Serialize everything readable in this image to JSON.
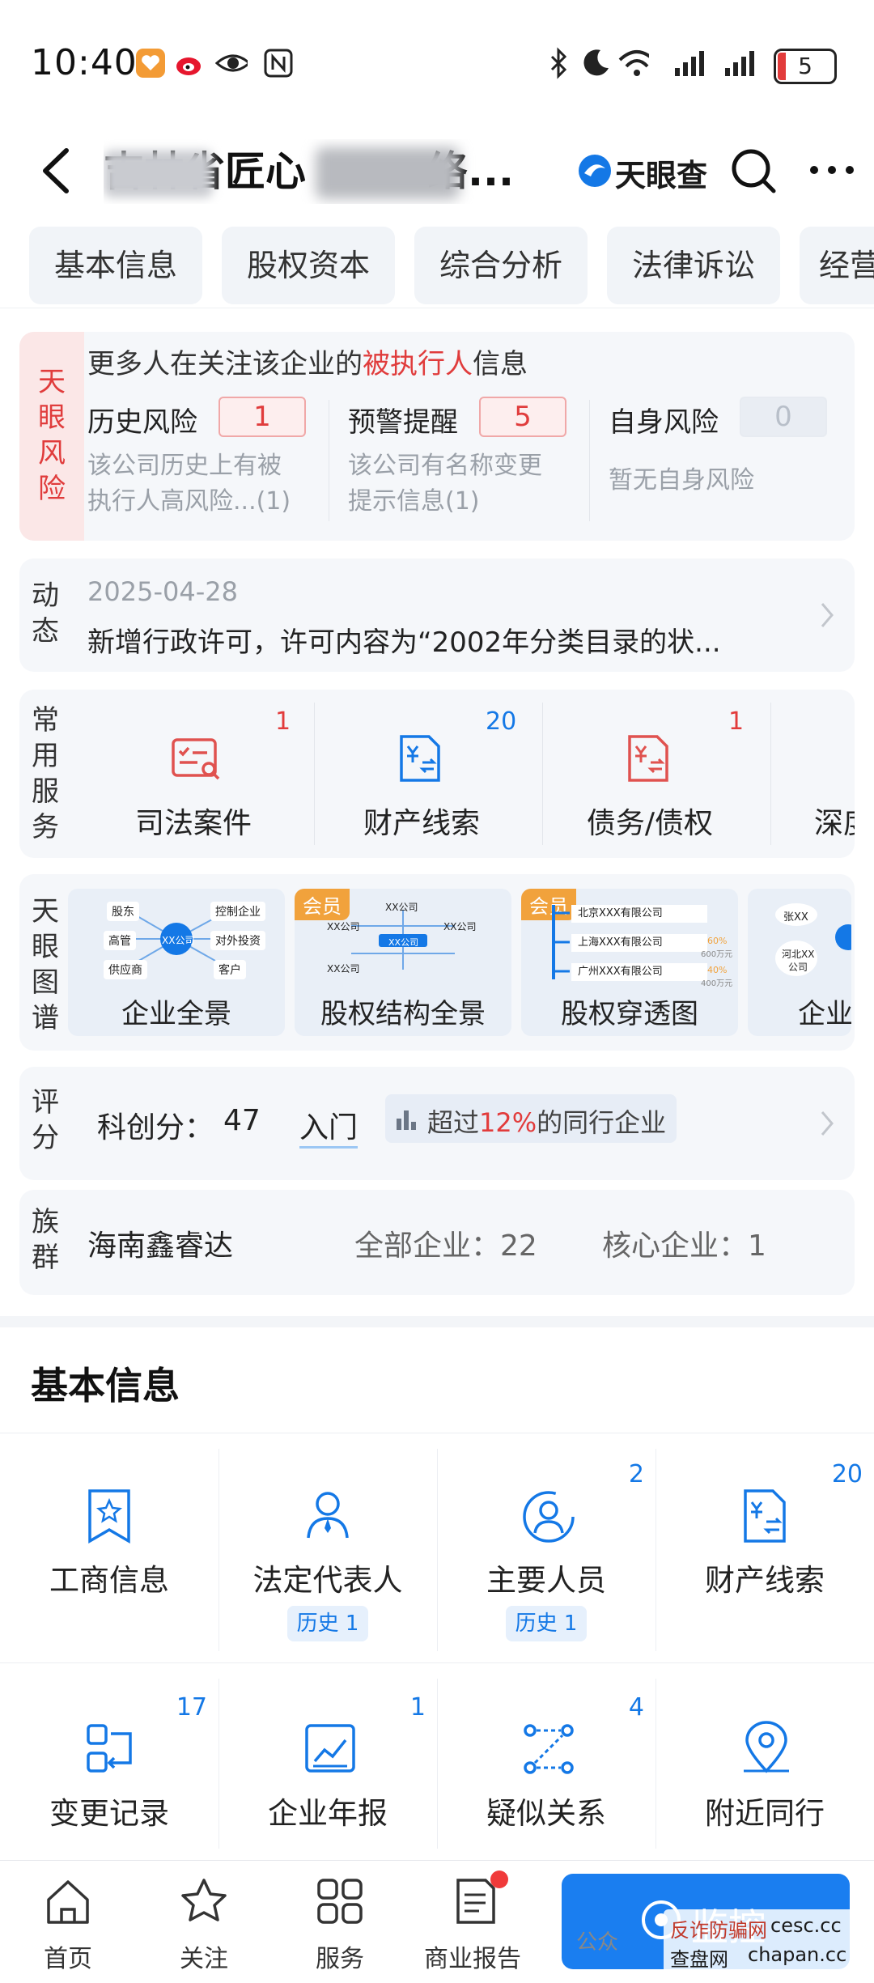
{
  "status_bar": {
    "time": "10:40",
    "battery": "5"
  },
  "header": {
    "title_left": "吉林省匠心",
    "title_right": "络...",
    "logo_text": "天眼查"
  },
  "tabs": [
    "基本信息",
    "股权资本",
    "综合分析",
    "法律诉讼",
    "经营"
  ],
  "risk": {
    "side_label": [
      "天",
      "眼",
      "风",
      "险"
    ],
    "headline_pre": "更多人在关注该企业的",
    "headline_red": "被执行人",
    "headline_post": "信息",
    "items": [
      {
        "title": "历史风险",
        "count": "1",
        "desc1": "该公司历史上有被",
        "desc2": "执行人高风险...(1)"
      },
      {
        "title": "预警提醒",
        "count": "5",
        "desc1": "该公司有名称变更",
        "desc2": "提示信息(1)"
      },
      {
        "title": "自身风险",
        "count": "0",
        "desc1": "暂无自身风险",
        "desc2": ""
      }
    ]
  },
  "news": {
    "side_label": [
      "动",
      "态"
    ],
    "date": "2025-04-28",
    "text": "新增行政许可，许可内容为“2002年分类目录的状..."
  },
  "services": {
    "side_label": [
      "常",
      "用",
      "服",
      "务"
    ],
    "items": [
      {
        "label": "司法案件",
        "count": "1",
        "icon": "judicial-case-icon"
      },
      {
        "label": "财产线索",
        "count": "20",
        "icon": "property-clue-icon"
      },
      {
        "label": "债务/债权",
        "count": "1",
        "icon": "debt-icon"
      },
      {
        "label": "深度",
        "count": "",
        "icon": "deep-icon"
      }
    ]
  },
  "graphs": {
    "side_label": [
      "天",
      "眼",
      "图",
      "谱"
    ],
    "items": [
      {
        "label": "企业全景",
        "vip": "",
        "nodes": [
          "股东",
          "控制企业",
          "高管",
          "XX公司",
          "对外投资",
          "供应商",
          "客户"
        ]
      },
      {
        "label": "股权结构全景",
        "vip": "会员",
        "nodes": [
          "XX公司",
          "XX公司",
          "XX公司",
          "XX公司",
          "XX公司"
        ]
      },
      {
        "label": "股权穿透图",
        "vip": "会员",
        "nodes": [
          "北京XXX有限公司",
          "上海XXX有限公司",
          "广州XXX有限公司",
          "60%",
          "600万元",
          "40%",
          "400万元"
        ]
      },
      {
        "label": "企业",
        "vip": "",
        "nodes": [
          "张XX",
          "河北XX",
          "公司"
        ]
      }
    ]
  },
  "score": {
    "side_label": [
      "评",
      "分"
    ],
    "label": "科创分：",
    "value": "47",
    "level": "入门",
    "exceed_pre": "超过",
    "exceed_pct": "12%",
    "exceed_post": "的同行企业"
  },
  "group": {
    "side_label": [
      "族",
      "群"
    ],
    "name": "海南鑫睿达",
    "all_label": "全部企业：",
    "all_count": "22",
    "core_label": "核心企业：",
    "core_count": "1"
  },
  "basic_info": {
    "title": "基本信息",
    "items": [
      {
        "label": "工商信息",
        "count": "",
        "history": "",
        "icon": "business-info-icon"
      },
      {
        "label": "法定代表人",
        "count": "",
        "history": "历史 1",
        "icon": "legal-rep-icon"
      },
      {
        "label": "主要人员",
        "count": "2",
        "history": "历史 1",
        "icon": "key-people-icon"
      },
      {
        "label": "财产线索",
        "count": "20",
        "history": "",
        "icon": "property-clue-icon"
      },
      {
        "label": "变更记录",
        "count": "17",
        "history": "",
        "icon": "change-record-icon"
      },
      {
        "label": "企业年报",
        "count": "1",
        "history": "",
        "icon": "annual-report-icon"
      },
      {
        "label": "疑似关系",
        "count": "4",
        "history": "",
        "icon": "relation-icon"
      },
      {
        "label": "附近同行",
        "count": "",
        "history": "",
        "icon": "location-icon"
      }
    ]
  },
  "bottom_nav": {
    "items": [
      {
        "label": "首页",
        "icon": "home-icon"
      },
      {
        "label": "关注",
        "icon": "star-icon"
      },
      {
        "label": "服务",
        "icon": "grid-icon"
      },
      {
        "label": "商业报告",
        "icon": "report-icon"
      }
    ],
    "monitor_label": "监控",
    "watermark_public": "公众",
    "watermark_site1": "反诈防骗网",
    "watermark_site2": "cesc.cc",
    "watermark_site3": "查盘网",
    "watermark_site4": "chapan.cc"
  },
  "colors": {
    "accent": "#1478e6",
    "risk_red": "#e03c3c",
    "vip_orange": "#f1a23c"
  }
}
